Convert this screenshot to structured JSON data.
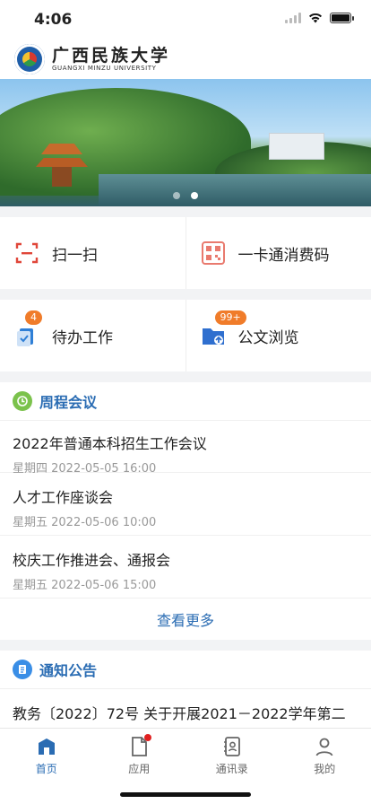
{
  "status": {
    "time": "4:06"
  },
  "header": {
    "school_cn": "广西民族大学",
    "school_en": "GUANGXI MINZU UNIVERSITY"
  },
  "banner": {
    "slide_count": 2,
    "active_slide": 2
  },
  "quick": {
    "scan_label": "扫一扫",
    "card_label": "一卡通消费码",
    "todo_label": "待办工作",
    "todo_badge": "4",
    "docs_label": "公文浏览",
    "docs_badge": "99+"
  },
  "meetings": {
    "title": "周程会议",
    "items": [
      {
        "title": "2022年普通本科招生工作会议",
        "time": "星期四 2022-05-05 16:00"
      },
      {
        "title": "人才工作座谈会",
        "time": "星期五 2022-05-06 10:00"
      },
      {
        "title": "校庆工作推进会、通报会",
        "time": "星期五 2022-05-06 15:00"
      }
    ],
    "more": "查看更多"
  },
  "notices": {
    "title": "通知公告",
    "first": "教务〔2022〕72号 关于开展2021－2022学年第二"
  },
  "tabs": [
    "首页",
    "应用",
    "通讯录",
    "我的"
  ],
  "colors": {
    "accent": "#2a6cb3",
    "badge": "#f07c2a",
    "red": "#e02020"
  }
}
